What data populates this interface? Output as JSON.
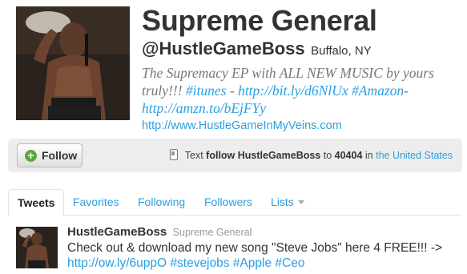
{
  "profile": {
    "display_name": "Supreme General",
    "screen_name": "@HustleGameBoss",
    "location": "Buffalo, NY",
    "bio": {
      "text_1": "The Supremacy EP with ALL NEW MUSIC by yours truly!!! ",
      "hashtag_itunes": "#itunes",
      "text_2": " - ",
      "link_1": "http://bit.ly/d6NlUx",
      "text_3": " ",
      "hashtag_amazon": "#Amazon",
      "text_4": "-",
      "link_2": "http://amzn.to/bEjFYy"
    },
    "website": "http://www.HustleGameInMyVeins.com"
  },
  "follow_bar": {
    "follow_label": "Follow",
    "plus_icon": "+",
    "sms_prefix": " Text ",
    "sms_command": "follow HustleGameBoss",
    "sms_to": " to ",
    "sms_number": "40404",
    "sms_in": " in ",
    "sms_country": "the United States"
  },
  "tabs": [
    {
      "label": "Tweets",
      "active": true
    },
    {
      "label": "Favorites",
      "active": false
    },
    {
      "label": "Following",
      "active": false
    },
    {
      "label": "Followers",
      "active": false
    },
    {
      "label": "Lists",
      "active": false
    }
  ],
  "tweet": {
    "author": "HustleGameBoss",
    "fullname": "Supreme General",
    "text_1": "Check out & download my new song \"Steve Jobs\" here 4 FREE!!! -> ",
    "link": "http://ow.ly/6uppO",
    "hashtag_1": "#stevejobs",
    "hashtag_2": "#Apple",
    "hashtag_3": "#Ceo"
  },
  "colors": {
    "link": "#2b9fe0",
    "follow_bar_bg": "#ededed",
    "plus_green": "#58a83d",
    "bio_gray": "#777777"
  }
}
